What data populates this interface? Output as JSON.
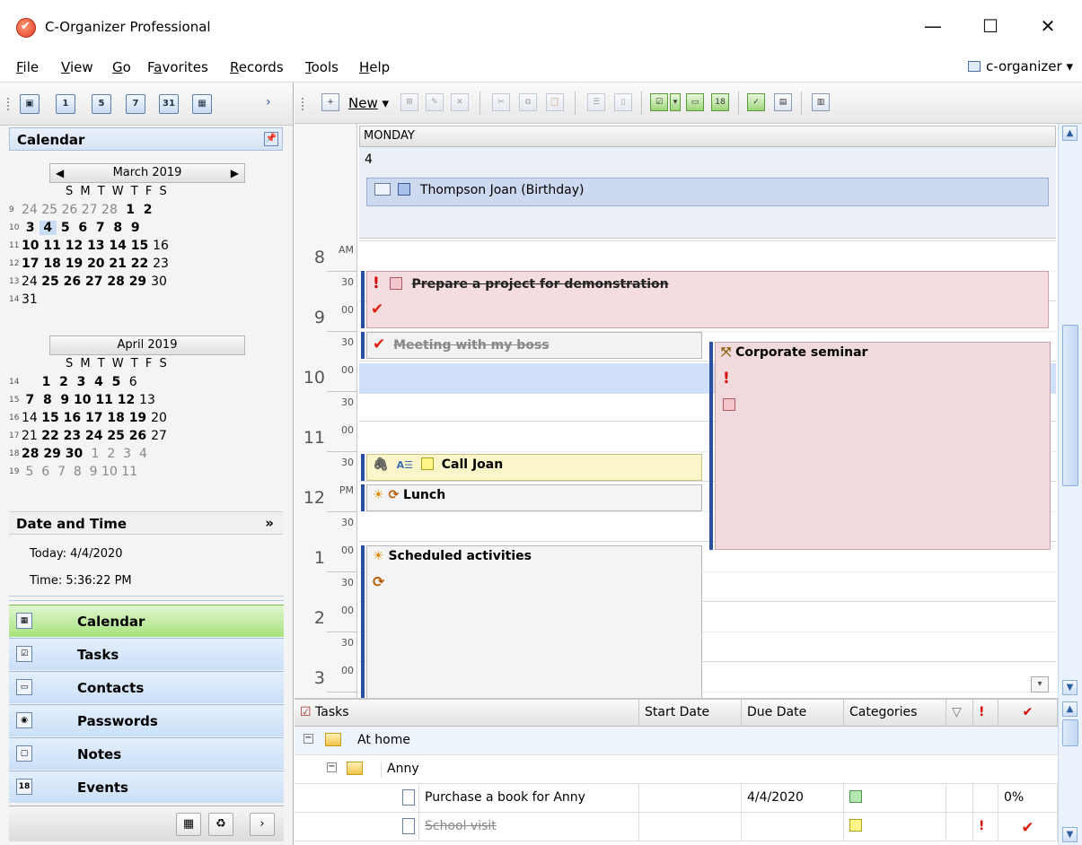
{
  "app": {
    "title": "C-Organizer Professional",
    "profile": "c-organizer"
  },
  "menu": [
    {
      "accel": "F",
      "rest": "ile"
    },
    {
      "accel": "V",
      "rest": "iew"
    },
    {
      "accel": "G",
      "rest": "o"
    },
    {
      "pre": "F",
      "accel": "a",
      "rest": "vorites"
    },
    {
      "accel": "R",
      "rest": "ecords"
    },
    {
      "accel": "T",
      "rest": "ools"
    },
    {
      "accel": "H",
      "rest": "elp"
    }
  ],
  "sidebar": {
    "calendar_header": "Calendar",
    "march": {
      "title": "March 2019",
      "dow": "S M T W T F S"
    },
    "april": {
      "title": "April 2019",
      "dow": "S M T W T F S"
    },
    "date_time_header": "Date and Time",
    "today_text": "Today: 4/4/2020",
    "time_text": "Time: 5:36:22 PM",
    "nav": [
      "Calendar",
      "Tasks",
      "Contacts",
      "Passwords",
      "Notes",
      "Events"
    ]
  },
  "toolbar": {
    "new_label": "New"
  },
  "dayview": {
    "day_name": "MONDAY",
    "day_number": "4",
    "allday_event": "Thompson Joan (Birthday)",
    "hours": [
      {
        "h": "8",
        "ampm": "AM"
      },
      {
        "h": "9",
        "ampm": "00"
      },
      {
        "h": "10",
        "ampm": "00"
      },
      {
        "h": "11",
        "ampm": "00"
      },
      {
        "h": "12",
        "ampm": "PM"
      },
      {
        "h": "1",
        "ampm": "00"
      },
      {
        "h": "2",
        "ampm": "00"
      },
      {
        "h": "3",
        "ampm": "00"
      }
    ],
    "half": "30",
    "events": {
      "prepare": "Prepare a project for demonstration",
      "meeting": "Meeting with my boss",
      "seminar": "Corporate seminar",
      "call": "Call Joan",
      "lunch": "Lunch",
      "scheduled": "Scheduled activities"
    },
    "important_mark": "!",
    "done_mark": "✔"
  },
  "tasks": {
    "columns": {
      "name": "Tasks",
      "start": "Start Date",
      "due": "Due Date",
      "categories": "Categories",
      "sort": "▽",
      "priority": "!",
      "done": "✔"
    },
    "rows": [
      {
        "name": "At home"
      },
      {
        "name": "Anny"
      },
      {
        "name": "Purchase a book for Anny",
        "due": "4/4/2020",
        "progress": "0%"
      },
      {
        "name": "School visit"
      }
    ]
  },
  "colors": {
    "accent": "#2a4fa0",
    "prepare_bg": "#f4dcdf",
    "seminar_bg": "#f1dadd",
    "call_bg": "#fbf6c9",
    "allday_bg": "#ccd9ee",
    "nav_selected": "#a7e17c"
  }
}
